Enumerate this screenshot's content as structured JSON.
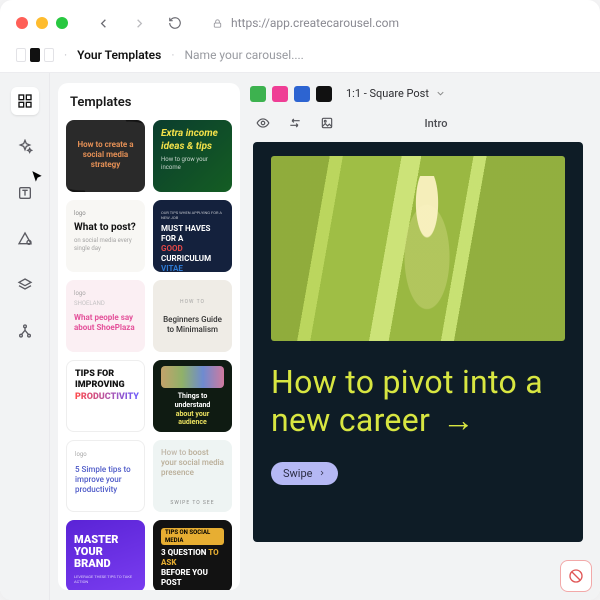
{
  "browser": {
    "url": "https://app.createcarousel.com"
  },
  "breadcrumb": {
    "current": "Your Templates",
    "placeholder": "Name your carousel...."
  },
  "panel": {
    "title": "Templates",
    "items": [
      {
        "l1": "How to create a",
        "l2": "social media",
        "l3": "strategy"
      },
      {
        "l1": "Extra income",
        "l2": "ideas & tips",
        "sub": "How to grow your income"
      },
      {
        "tag": "logo",
        "l1": "What to post?",
        "sub": "on social media every single day"
      },
      {
        "tag": "OUR TIPS WHEN APPLYING FOR A NEW JOB",
        "l1": "MUST HAVES FOR A",
        "hl1": "GOOD",
        "l2": " CURRICULUM",
        "hl2": "VITAE"
      },
      {
        "tag": "logo",
        "sub1": "SHOELAND",
        "l1": "What people say about ",
        "brand": "ShoePlaza"
      },
      {
        "tag": "HOW TO",
        "l1": "Beginners Guide to Minimalism"
      },
      {
        "l1": "TIPS FOR",
        "l2": "IMPROVING",
        "l3": "PRODUCTIVITY"
      },
      {
        "l1": "Things to understand",
        "u": "about your audience"
      },
      {
        "tag": "logo",
        "l1": "5 Simple tips to ",
        "sp": "improve your productivity"
      },
      {
        "l1": "How to ",
        "sp": "boost your social media presence",
        "cta": "SWIPE TO SEE"
      },
      {
        "l1": "MASTER",
        "l2": "YOUR BRAND",
        "sub": "LEVERAGE THESE TIPS TO TAKE ACTION"
      },
      {
        "pill": "TIPS ON SOCIAL MEDIA",
        "l1": "3 QUESTION ",
        "sp": "TO ASK",
        "l2": "BEFORE YOU POST"
      }
    ]
  },
  "canvas": {
    "size_label": "1:1 - Square Post",
    "slide_name": "Intro",
    "headline": "How to pivot into a new career",
    "swipe_label": "Swipe"
  },
  "colors": {
    "slide_bg": "#0e1c26",
    "headline_color": "#d8e641",
    "swipe_bg": "#b5b8f4"
  }
}
